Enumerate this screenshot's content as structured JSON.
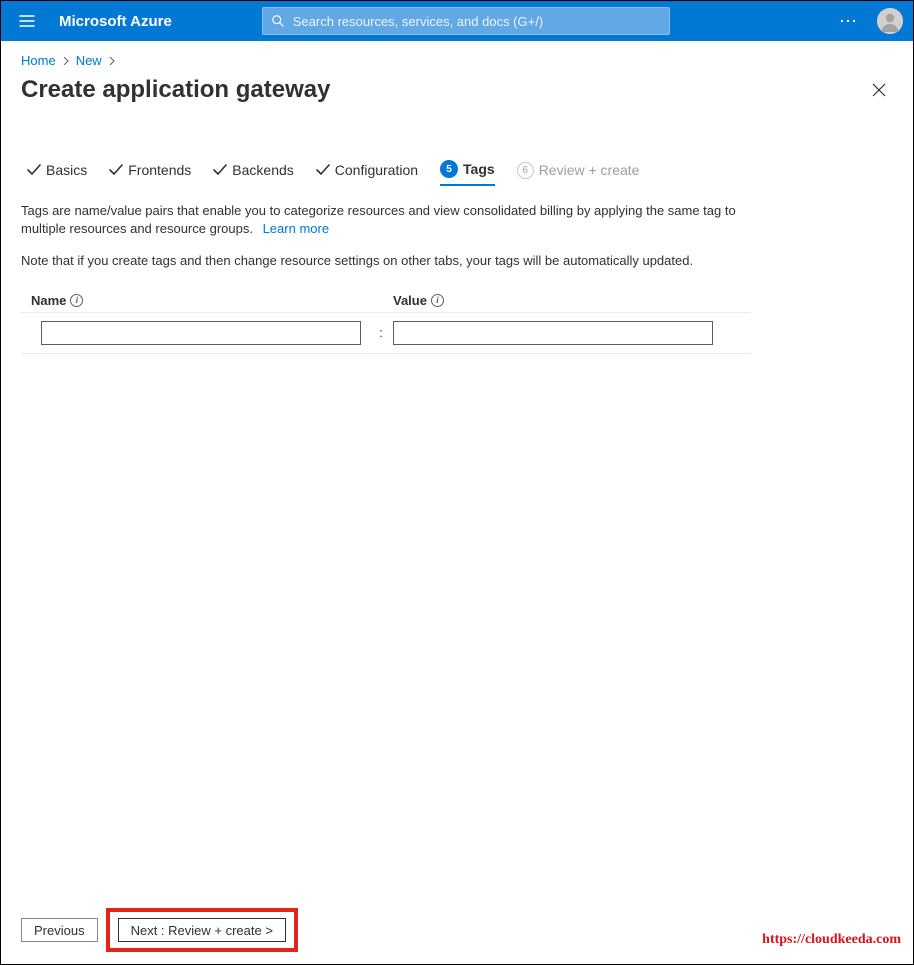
{
  "header": {
    "brand": "Microsoft Azure",
    "search_placeholder": "Search resources, services, and docs (G+/)"
  },
  "breadcrumb": {
    "items": [
      "Home",
      "New"
    ]
  },
  "page": {
    "title": "Create application gateway"
  },
  "tabs": {
    "items": [
      {
        "label": "Basics"
      },
      {
        "label": "Frontends"
      },
      {
        "label": "Backends"
      },
      {
        "label": "Configuration"
      },
      {
        "label": "Tags",
        "step": "5"
      },
      {
        "label": "Review + create",
        "step": "6"
      }
    ]
  },
  "content": {
    "description": "Tags are name/value pairs that enable you to categorize resources and view consolidated billing by applying the same tag to multiple resources and resource groups.",
    "learn_more": "Learn more",
    "note": "Note that if you create tags and then change resource settings on other tabs, your tags will be automatically updated."
  },
  "tag_table": {
    "col_name": "Name",
    "col_value": "Value",
    "row": {
      "name": "",
      "value": ""
    }
  },
  "footer": {
    "previous": "Previous",
    "next": "Next : Review + create >"
  },
  "watermark": "https://cloudkeeda.com"
}
